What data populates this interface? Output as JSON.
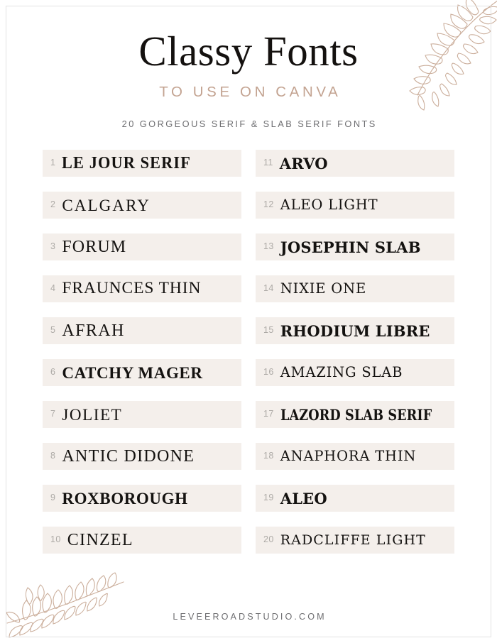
{
  "header": {
    "title": "Classy Fonts",
    "subtitle": "TO USE ON CANVA",
    "kicker": "20 GORGEOUS SERIF & SLAB SERIF FONTS"
  },
  "colors": {
    "page_background": "#ffffff",
    "row_background": "#f4efeb",
    "accent_tan": "#c3a391",
    "title_ink": "#14110f",
    "muted_text": "#6f6f72",
    "number_grey": "#adaaa6",
    "border_grey": "#e3e3e3",
    "frond_line": "#cbae9b"
  },
  "decorations": [
    {
      "name": "fern-frond-top-right",
      "position": "top-right"
    },
    {
      "name": "fern-frond-bottom-left",
      "position": "bottom-left"
    }
  ],
  "list": {
    "left_column": [
      {
        "number": "1",
        "name": "LE JOUR SERIF",
        "style": "s-bold-cond"
      },
      {
        "number": "2",
        "name": "CALGARY",
        "style": "s-light-wide"
      },
      {
        "number": "3",
        "name": "FORUM",
        "style": "s-reg"
      },
      {
        "number": "4",
        "name": "FRAUNCES THIN",
        "style": "s-thin"
      },
      {
        "number": "5",
        "name": "AFRAH",
        "style": "s-thin-lite"
      },
      {
        "number": "6",
        "name": "CATCHY MAGER",
        "style": "s-serif-bold"
      },
      {
        "number": "7",
        "name": "JOLIET",
        "style": "s-thin-gray"
      },
      {
        "number": "8",
        "name": "ANTIC DIDONE",
        "style": "s-didone"
      },
      {
        "number": "9",
        "name": "ROXBOROUGH",
        "style": "s-serif-bold"
      },
      {
        "number": "10",
        "name": "CINZEL",
        "style": "s-didone"
      }
    ],
    "right_column": [
      {
        "number": "11",
        "name": "ARVO",
        "style": "s-slab-bold"
      },
      {
        "number": "12",
        "name": "ALEO LIGHT",
        "style": "s-slab-light"
      },
      {
        "number": "13",
        "name": "JOSEPHIN SLAB",
        "style": "s-slab-bold"
      },
      {
        "number": "14",
        "name": "NIXIE ONE",
        "style": "s-slab-light-pale"
      },
      {
        "number": "15",
        "name": "RHODIUM LIBRE",
        "style": "s-slab-bold"
      },
      {
        "number": "16",
        "name": "AMAZING SLAB",
        "style": "s-slab-light-pale"
      },
      {
        "number": "17",
        "name": "LAZORD SLAB SERIF",
        "style": "s-slab-cond-bold"
      },
      {
        "number": "18",
        "name": "ANAPHORA THIN",
        "style": "s-slab-light-pale"
      },
      {
        "number": "19",
        "name": "ALEO",
        "style": "s-slab-bold"
      },
      {
        "number": "20",
        "name": "RADCLIFFE LIGHT",
        "style": "s-slab-reg"
      }
    ]
  },
  "footer": {
    "website": "LEVEEROADSTUDIO.COM"
  }
}
